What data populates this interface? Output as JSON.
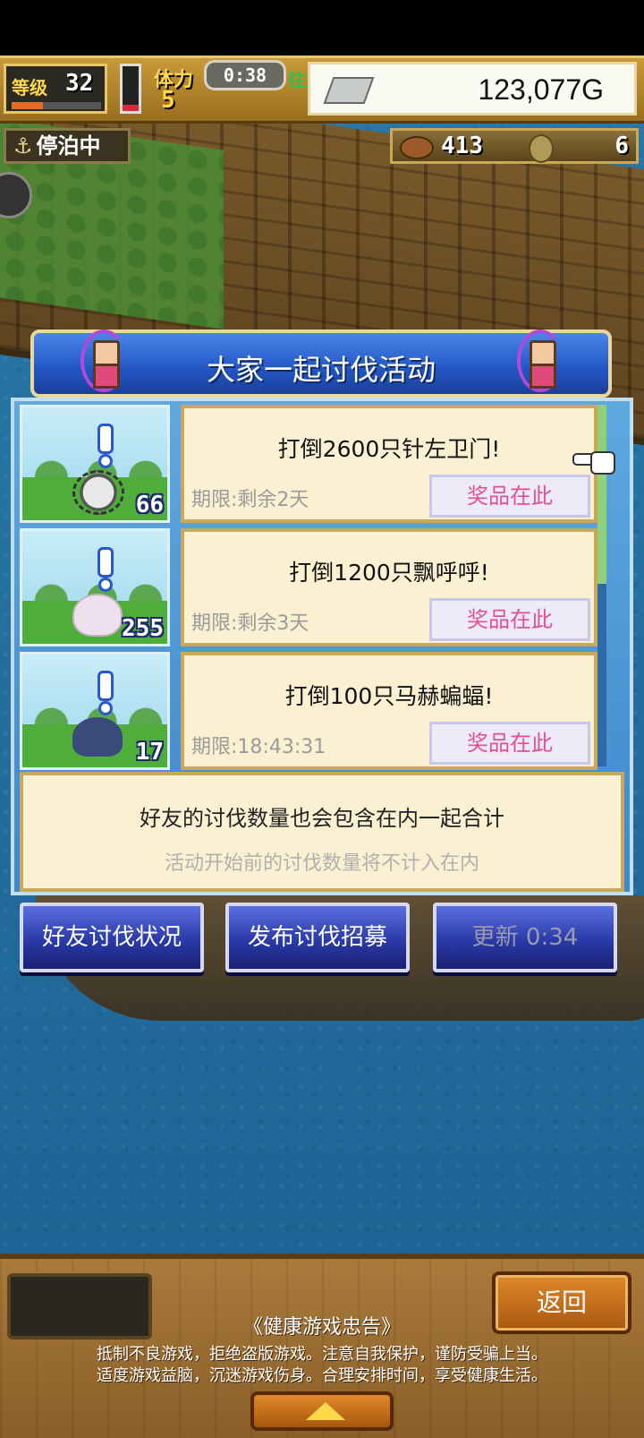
{
  "hud": {
    "level_label": "等级",
    "level_value": "32",
    "level_progress": 0.35,
    "stamina_label": "体力",
    "stamina_value": "5",
    "stamina_gauge": 0.15,
    "timer": "0:38",
    "partial_text": "往活开",
    "money": "123,077G",
    "docked_label": "停泊中",
    "resource1_value": "413",
    "resource2_value": "6"
  },
  "event": {
    "title": "大家一起讨伐活动",
    "quests": [
      {
        "title": "打倒2600只针左卫门!",
        "deadline": "期限:剩余2天",
        "reward_label": "奖品在此",
        "count": "66",
        "monster": "spike-monster-icon"
      },
      {
        "title": "打倒1200只飘呼呼!",
        "deadline": "期限:剩余3天",
        "reward_label": "奖品在此",
        "count": "255",
        "monster": "ghost-monster-icon"
      },
      {
        "title": "打倒100只马赫蝙蝠!",
        "deadline": "期限:18:43:31",
        "reward_label": "奖品在此",
        "count": "17",
        "monster": "bat-monster-icon"
      }
    ],
    "note_main": "好友的讨伐数量也会包含在内一起合计",
    "note_sub": "活动开始前的讨伐数量将不计入在内"
  },
  "buttons": {
    "friend_status": "好友讨伐状况",
    "post_recruit": "发布讨伐招募",
    "refresh": "更新 0:34"
  },
  "footer": {
    "back_label": "返回",
    "notice_title": "《健康游戏忠告》",
    "notice_line1": "抵制不良游戏，拒绝盗版游戏。注意自我保护，谨防受骗上当。",
    "notice_line2": "适度游戏益脑，沉迷游戏伤身。合理安排时间，享受健康生活。"
  },
  "colors": {
    "panel_blue": "#2256c4",
    "card_cream": "#fbf0d2",
    "reward_pink": "#e0509a",
    "button_navy": "#2a3aa8"
  }
}
